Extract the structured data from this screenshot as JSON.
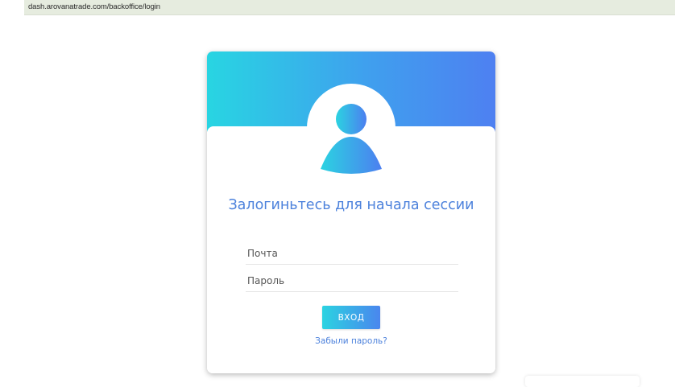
{
  "browser": {
    "url": "dash.arovanatrade.com/backoffice/login"
  },
  "login": {
    "title": "Залогиньтесь для начала сессии",
    "email_placeholder": "Почта",
    "password_placeholder": "Пароль",
    "submit_label": "ВХОД",
    "forgot_label": "Забыли пароль?"
  },
  "icons": {
    "avatar": "user-avatar-icon"
  },
  "colors": {
    "gradient_start": "#28d5e2",
    "gradient_end": "#4e80f1",
    "title_color": "#4d82dc",
    "link_color": "#4d82dc"
  }
}
